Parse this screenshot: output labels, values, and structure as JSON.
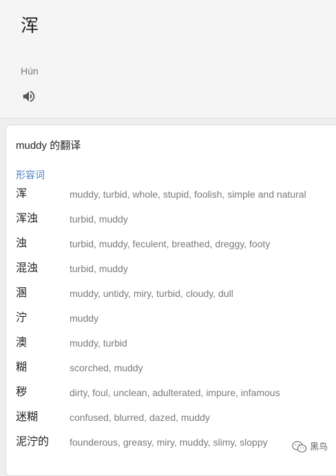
{
  "source": {
    "word": "浑",
    "pinyin": "Hún",
    "speaker_icon": "volume-icon"
  },
  "card": {
    "title": "muddy 的翻译",
    "part_of_speech": "形容词",
    "entries": [
      {
        "word": "浑",
        "translations": "muddy, turbid, whole, stupid, foolish, simple and natural"
      },
      {
        "word": "浑浊",
        "translations": "turbid, muddy"
      },
      {
        "word": "浊",
        "translations": "turbid, muddy, feculent, breathed, dreggy, footy"
      },
      {
        "word": "混浊",
        "translations": "turbid, muddy"
      },
      {
        "word": "溷",
        "translations": "muddy, untidy, miry, turbid, cloudy, dull"
      },
      {
        "word": "泞",
        "translations": "muddy"
      },
      {
        "word": "澳",
        "translations": "muddy, turbid"
      },
      {
        "word": "糊",
        "translations": "scorched, muddy"
      },
      {
        "word": "秽",
        "translations": "dirty, foul, unclean, adulterated, impure, infamous"
      },
      {
        "word": "迷糊",
        "translations": "confused, blurred, dazed, muddy"
      },
      {
        "word": "泥泞的",
        "translations": "founderous, greasy, miry, muddy, slimy, sloppy"
      }
    ]
  },
  "watermark": {
    "text": "黑鸟",
    "icon": "wechat-icon"
  },
  "colors": {
    "pos_label": "#4a7fc1",
    "translation_text": "#7a7a7a",
    "top_panel_bg": "#f5f5f5"
  }
}
